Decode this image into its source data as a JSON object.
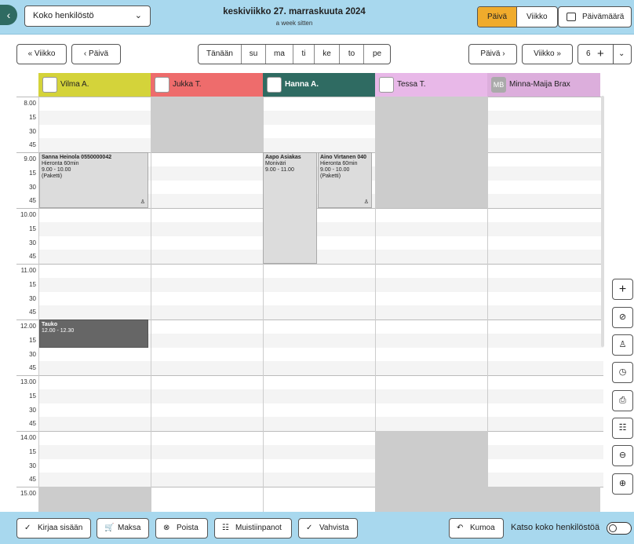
{
  "header": {
    "back_icon": "chevron-left-icon",
    "staff_select": "Koko henkilöstö",
    "date_title": "keskiviikko 27. marraskuuta 2024",
    "date_relative": "a week sitten",
    "view_day": "Päivä",
    "view_week": "Viikko",
    "date_picker": "Päivämäärä",
    "active_view_color": "#f0ab2c"
  },
  "nav": {
    "prev_week": "Viikko",
    "prev_day": "Päivä",
    "today": "Tänään",
    "days": [
      "su",
      "ma",
      "ti",
      "ke",
      "to",
      "pe"
    ],
    "next_day": "Päivä",
    "next_week": "Viikko",
    "columns_count": "6"
  },
  "staff": [
    {
      "name": "Vilma A.",
      "color": "#d4d33a"
    },
    {
      "name": "Jukka T.",
      "color": "#ee6c6c"
    },
    {
      "name": "Hanna A.",
      "color": "#2f6b62"
    },
    {
      "name": "Tessa T.",
      "color": "#e8b8e8"
    },
    {
      "name": "Minna-Maija Brax",
      "color": "#dcaedc",
      "initials": "MB"
    }
  ],
  "time_slots": [
    "8.00",
    "15",
    "30",
    "45",
    "9.00",
    "15",
    "30",
    "45",
    "10.00",
    "15",
    "30",
    "45",
    "11.00",
    "15",
    "30",
    "45",
    "12.00",
    "15",
    "30",
    "45",
    "13.00",
    "15",
    "30",
    "45",
    "14.00",
    "15",
    "30",
    "45",
    "15.00"
  ],
  "appointments": [
    {
      "title": "Sanna Heinola 0550000042",
      "service": "Hieronta 60min",
      "time": "9.00 - 10.00",
      "note": "(Paketti)"
    },
    {
      "title": "Aapo Asiakas",
      "service": "Moniväri",
      "time": "9.00 - 11.00"
    },
    {
      "title": "Aino Virtanen 040",
      "service": "Hieronta 60min",
      "time": "9.00 - 10.00",
      "note": "(Paketti)"
    },
    {
      "title": "Tauko",
      "time": "12.00 - 12.30"
    }
  ],
  "footer": {
    "checkin": "Kirjaa sisään",
    "pay": "Maksa",
    "delete": "Poista",
    "notes": "Muistiinpanot",
    "confirm": "Vahvista",
    "undo": "Kumoa",
    "show_all_staff": "Katso koko henkilöstöä"
  },
  "side_tools": [
    "plus-icon",
    "eye-off-icon",
    "group-icon",
    "clock-icon",
    "printer-icon",
    "clipboard-icon",
    "zoom-out-icon",
    "zoom-in-icon"
  ]
}
